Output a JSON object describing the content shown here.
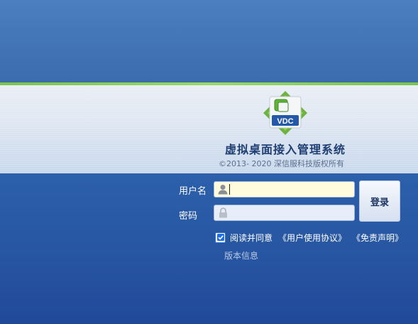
{
  "app": {
    "title": "虚拟桌面接入管理系统",
    "copyright": "©2013- 2020  深信服科技版权所有",
    "logo_text": "VDC"
  },
  "login": {
    "username_label": "用户名",
    "password_label": "密码",
    "username_value": "",
    "password_value": "",
    "submit_label": "登录"
  },
  "agreement": {
    "checked": true,
    "text": "阅读并同意",
    "user_agreement_link": "《用户使用协议》",
    "disclaimer_link": "《免责声明》"
  },
  "footer": {
    "version_link": "版本信息"
  },
  "colors": {
    "accent_green": "#7cc34f",
    "background_blue": "#2a5aa6",
    "title_text": "#1f3f73"
  },
  "icons": {
    "user": "user-icon",
    "lock": "lock-icon",
    "logo": "vdc-logo-icon",
    "check": "check-icon"
  }
}
